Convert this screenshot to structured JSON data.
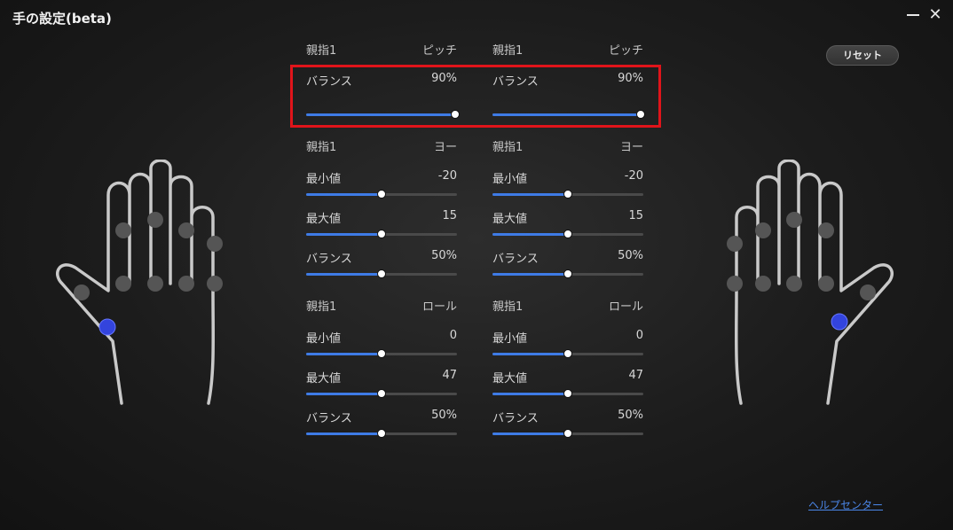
{
  "window": {
    "title": "手の設定(beta)",
    "minimize_label": "",
    "close_label": "✕"
  },
  "reset_label": "リセット",
  "help_link": "ヘルプセンター",
  "left": {
    "pitch_header": {
      "finger": "親指1",
      "axis": "ピッチ"
    },
    "pitch_balance": {
      "label": "バランス",
      "value": "90%",
      "level": 0.99
    },
    "yaw_header": {
      "finger": "親指1",
      "axis": "ヨー"
    },
    "yaw_min": {
      "label": "最小値",
      "value": "-20",
      "level": 0.5
    },
    "yaw_max": {
      "label": "最大値",
      "value": "15",
      "level": 0.5
    },
    "yaw_balance": {
      "label": "バランス",
      "value": "50%",
      "level": 0.5
    },
    "roll_header": {
      "finger": "親指1",
      "axis": "ロール"
    },
    "roll_min": {
      "label": "最小値",
      "value": "0",
      "level": 0.5
    },
    "roll_max": {
      "label": "最大値",
      "value": "47",
      "level": 0.5
    },
    "roll_balance": {
      "label": "バランス",
      "value": "50%",
      "level": 0.5
    }
  },
  "right": {
    "pitch_header": {
      "finger": "親指1",
      "axis": "ピッチ"
    },
    "pitch_balance": {
      "label": "バランス",
      "value": "90%",
      "level": 0.98
    },
    "yaw_header": {
      "finger": "親指1",
      "axis": "ヨー"
    },
    "yaw_min": {
      "label": "最小値",
      "value": "-20",
      "level": 0.5
    },
    "yaw_max": {
      "label": "最大値",
      "value": "15",
      "level": 0.5
    },
    "yaw_balance": {
      "label": "バランス",
      "value": "50%",
      "level": 0.5
    },
    "roll_header": {
      "finger": "親指1",
      "axis": "ロール"
    },
    "roll_min": {
      "label": "最小値",
      "value": "0",
      "level": 0.5
    },
    "roll_max": {
      "label": "最大値",
      "value": "47",
      "level": 0.5
    },
    "roll_balance": {
      "label": "バランス",
      "value": "50%",
      "level": 0.5
    }
  },
  "colors": {
    "accent": "#3e7be6",
    "highlight": "#e0141a",
    "joint": "#555555",
    "active_joint": "#3344dd"
  },
  "icons": {
    "left_hand": "left-hand-icon",
    "right_hand": "right-hand-icon"
  }
}
